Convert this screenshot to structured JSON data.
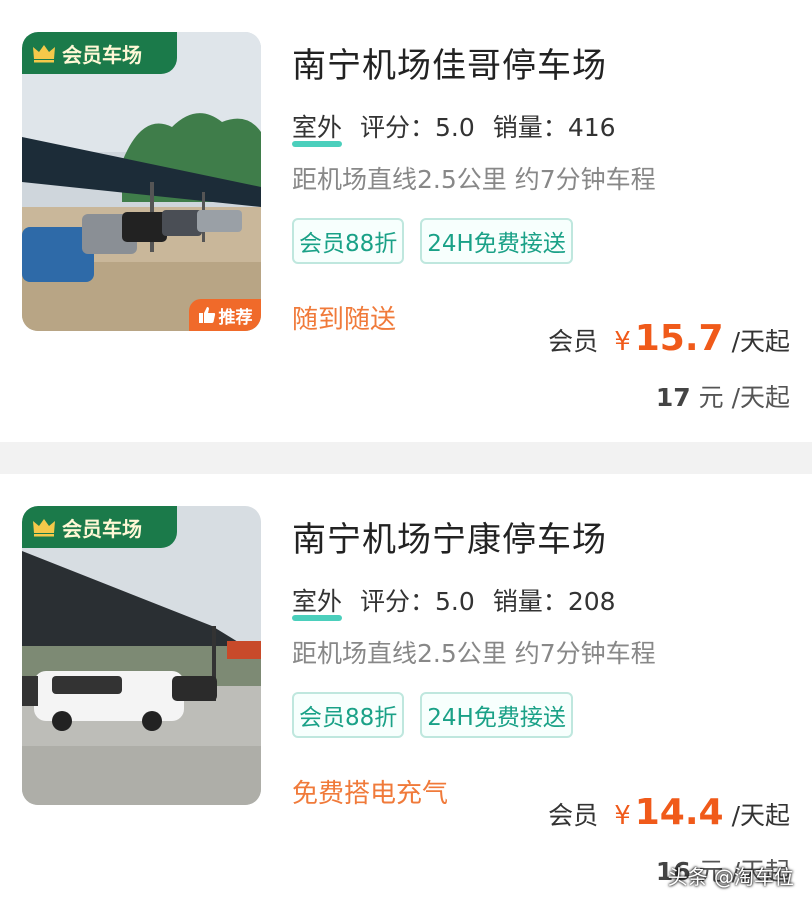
{
  "listings": [
    {
      "member_tag": "会员车场",
      "recommend_tag": "推荐",
      "name": "南宁机场佳哥停车场",
      "type": "室外",
      "rating_label": "评分：",
      "rating": "5.0",
      "sales_label": "销量：",
      "sales": "416",
      "distance": "距机场直线2.5公里 约7分钟车程",
      "tags": [
        "会员88折",
        "24H免费接送"
      ],
      "feature": "随到随送",
      "member_label": "会员",
      "currency": "¥",
      "member_price": "15.7",
      "price_unit": "/天起",
      "original_price": "17",
      "original_unit": "元 /天起"
    },
    {
      "member_tag": "会员车场",
      "name": "南宁机场宁康停车场",
      "type": "室外",
      "rating_label": "评分：",
      "rating": "5.0",
      "sales_label": "销量：",
      "sales": "208",
      "distance": "距机场直线2.5公里 约7分钟车程",
      "tags": [
        "会员88折",
        "24H免费接送"
      ],
      "feature": "免费搭电充气",
      "member_label": "会员",
      "currency": "¥",
      "member_price": "14.4",
      "price_unit": "/天起",
      "original_price": "16",
      "original_unit": "元 /天起"
    }
  ],
  "watermark": "头条 @淘车位",
  "colors": {
    "member_green": "#1b7a4a",
    "price_orange": "#f05a1a",
    "tag_teal": "#1aa187",
    "recommend_orange": "#f06a2a"
  },
  "icons": [
    "crown-icon",
    "thumbs-up-icon"
  ]
}
